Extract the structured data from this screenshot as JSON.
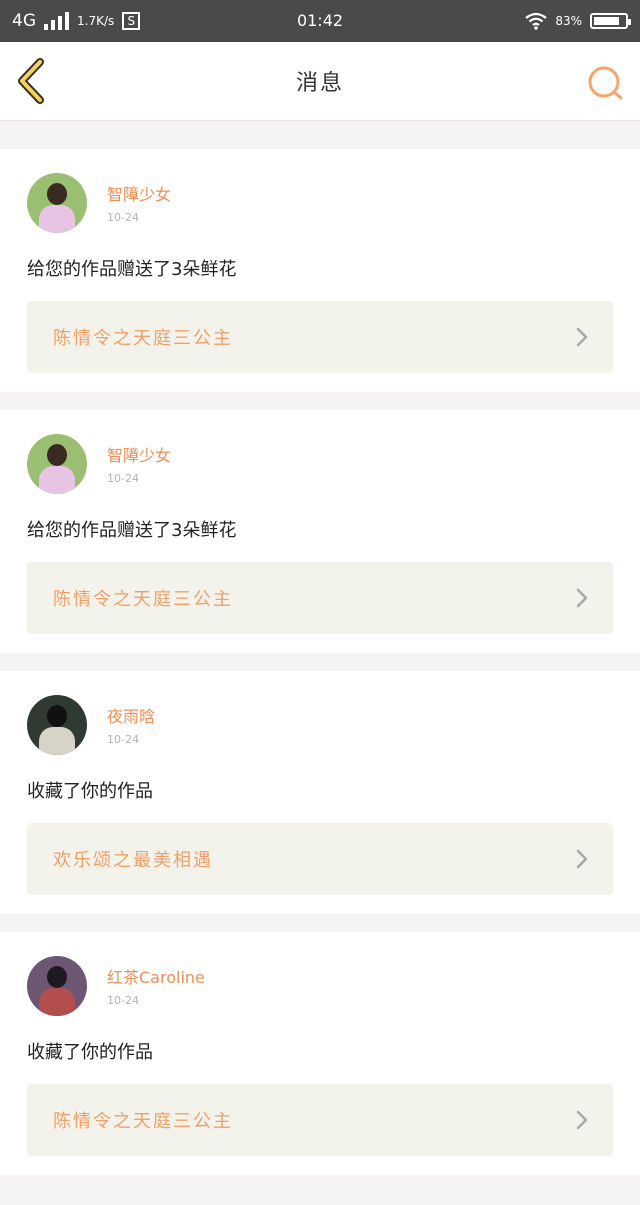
{
  "status_bar": {
    "network": "4G",
    "speed": "1.7K/s",
    "s_badge": "S",
    "time": "01:42",
    "battery_percent": "83%",
    "battery_level": 0.83
  },
  "header": {
    "title": "消息",
    "back_icon": "chevron-left-icon",
    "search_icon": "search-icon"
  },
  "accent_color": "#f08e56",
  "notifications": [
    {
      "username": "智障少女",
      "date": "10-24",
      "message": "给您的作品赠送了3朵鲜花",
      "work_title": "陈情令之天庭三公主"
    },
    {
      "username": "智障少女",
      "date": "10-24",
      "message": "给您的作品赠送了3朵鲜花",
      "work_title": "陈情令之天庭三公主"
    },
    {
      "username": "夜雨晗",
      "date": "10-24",
      "message": "收藏了你的作品",
      "work_title": "欢乐颂之最美相遇"
    },
    {
      "username": "红茶Caroline",
      "date": "10-24",
      "message": "收藏了你的作品",
      "work_title": "陈情令之天庭三公主"
    }
  ]
}
